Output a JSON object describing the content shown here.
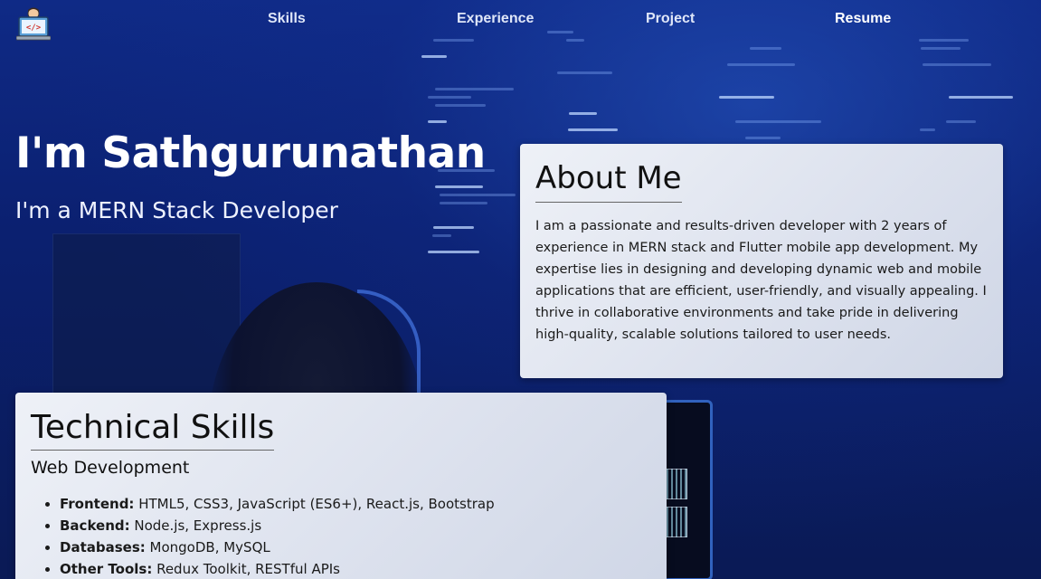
{
  "nav": {
    "logo_icon": "developer-laptop-logo-icon",
    "items": [
      {
        "label": "Skills"
      },
      {
        "label": "Experience"
      },
      {
        "label": "Project"
      },
      {
        "label": "Resume"
      }
    ]
  },
  "hero": {
    "name": "I'm Sathgurunathan",
    "role": "I'm a MERN Stack Developer"
  },
  "about": {
    "title": "About Me",
    "text": "I am a passionate and results-driven developer with 2 years of experience in MERN stack and Flutter mobile app development. My expertise lies in designing and developing dynamic web and mobile applications that are efficient, user-friendly, and visually appealing. I thrive in collaborative environments and take pride in delivering high-quality, scalable solutions tailored to user needs."
  },
  "skills": {
    "title": "Technical Skills",
    "subtitle": "Web Development",
    "items": [
      {
        "label": "Frontend:",
        "value": " HTML5, CSS3, JavaScript (ES6+), React.js, Bootstrap"
      },
      {
        "label": "Backend:",
        "value": " Node.js, Express.js"
      },
      {
        "label": "Databases:",
        "value": " MongoDB, MySQL"
      },
      {
        "label": "Other Tools:",
        "value": " Redux Toolkit, RESTful APIs"
      }
    ]
  },
  "colors": {
    "background": "#0d1e5a",
    "card": "#e4e8f1",
    "text": "#1a1a1a"
  }
}
